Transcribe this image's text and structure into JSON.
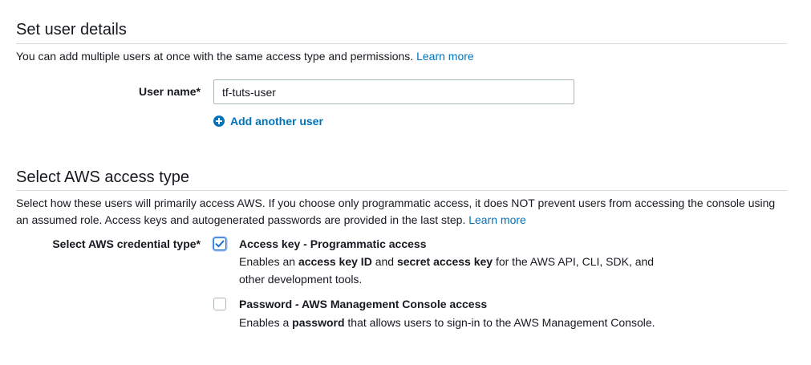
{
  "user_details": {
    "title": "Set user details",
    "description": "You can add multiple users at once with the same access type and permissions.",
    "learn_more": "Learn more",
    "user_name_label": "User name*",
    "user_name_value": "tf-tuts-user",
    "add_user_label": "Add another user"
  },
  "access_type": {
    "title": "Select AWS access type",
    "description": "Select how these users will primarily access AWS. If you choose only programmatic access, it does NOT prevent users from accessing the console using an assumed role. Access keys and autogenerated passwords are provided in the last step.",
    "learn_more": "Learn more",
    "credential_label": "Select AWS credential type*",
    "options": [
      {
        "title": "Access key - Programmatic access",
        "checked": true,
        "desc_pre": "Enables an ",
        "desc_b1": "access key ID",
        "desc_mid": " and ",
        "desc_b2": "secret access key",
        "desc_post": " for the AWS API, CLI, SDK, and",
        "desc_line2": "other development tools."
      },
      {
        "title": "Password - AWS Management Console access",
        "checked": false,
        "desc_pre": "Enables a ",
        "desc_b1": "password",
        "desc_post": " that allows users to sign-in to the AWS Management Console."
      }
    ]
  },
  "colors": {
    "link": "#0073bb",
    "checkbox_checked": "#1b6fd1",
    "divider": "#d5dbdb"
  },
  "icons": {
    "add_user": "plus-circle-icon",
    "checkbox_checked": "checkmark-icon"
  }
}
